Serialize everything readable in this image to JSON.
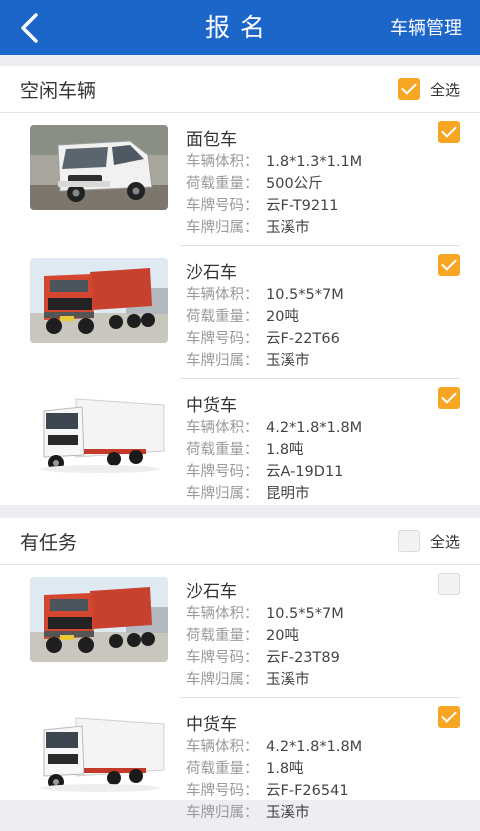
{
  "header": {
    "title": "报名",
    "manage_label": "车辆管理"
  },
  "field_labels": {
    "volume": "车辆体积：",
    "load": "荷载重量：",
    "plate": "车牌号码：",
    "city": "车牌归属："
  },
  "colors": {
    "header_bg": "#1c66c9",
    "checkbox_on": "#f6a623"
  },
  "idle": {
    "title": "空闲车辆",
    "select_all_label": "全选",
    "select_all_checked": true,
    "vehicles": [
      {
        "name": "面包车",
        "volume": "1.8*1.3*1.1M",
        "load": "500公斤",
        "plate": "云F-T9211",
        "city": "玉溪市",
        "checked": true,
        "image": "van-photo"
      },
      {
        "name": "沙石车",
        "volume": "10.5*5*7M",
        "load": "20吨",
        "plate": "云F-22T66",
        "city": "玉溪市",
        "checked": true,
        "image": "dump-truck-photo"
      },
      {
        "name": "中货车",
        "volume": "4.2*1.8*1.8M",
        "load": "1.8吨",
        "plate": "云A-19D11",
        "city": "昆明市",
        "checked": true,
        "image": "box-truck-photo"
      }
    ]
  },
  "tasked": {
    "title": "有任务",
    "select_all_label": "全选",
    "select_all_checked": false,
    "vehicles": [
      {
        "name": "沙石车",
        "volume": "10.5*5*7M",
        "load": "20吨",
        "plate": "云F-23T89",
        "city": "玉溪市",
        "checked": false,
        "image": "dump-truck-photo"
      },
      {
        "name": "中货车",
        "volume": "4.2*1.8*1.8M",
        "load": "1.8吨",
        "plate": "云F-F26541",
        "city": "玉溪市",
        "checked": true,
        "image": "box-truck-photo"
      }
    ]
  }
}
